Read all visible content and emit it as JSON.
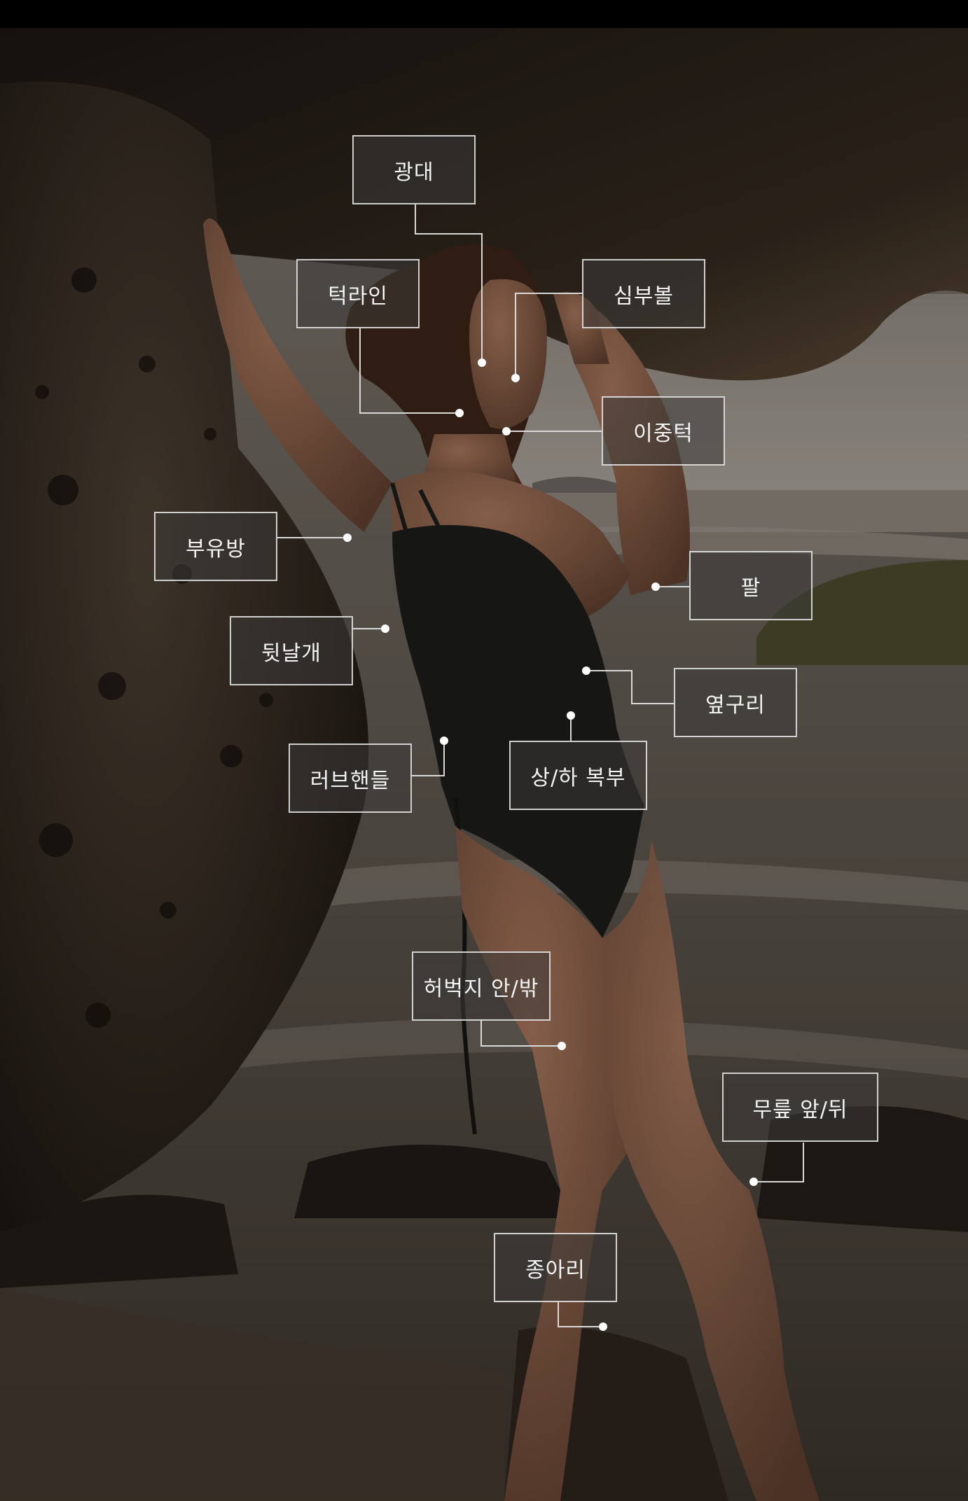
{
  "colors": {
    "label_border": "#ebebeb",
    "label_fill": "#3c3a38",
    "label_text": "#f4f4f4",
    "leader_line": "#d9d9d9",
    "dot": "#ffffff"
  },
  "labels": [
    {
      "id": "cheekbone",
      "text": "광대"
    },
    {
      "id": "jawline",
      "text": "턱라인"
    },
    {
      "id": "buccal-fat",
      "text": "심부볼"
    },
    {
      "id": "double-chin",
      "text": "이중턱"
    },
    {
      "id": "accessory-breast",
      "text": "부유방"
    },
    {
      "id": "arm",
      "text": "팔"
    },
    {
      "id": "back-wing",
      "text": "뒷날개"
    },
    {
      "id": "flank",
      "text": "옆구리"
    },
    {
      "id": "love-handles",
      "text": "러브핸들"
    },
    {
      "id": "abdomen",
      "text": "상/하 복부"
    },
    {
      "id": "thigh",
      "text": "허벅지 안/밖"
    },
    {
      "id": "knee",
      "text": "무릎 앞/뒤"
    },
    {
      "id": "calf",
      "text": "종아리"
    }
  ]
}
